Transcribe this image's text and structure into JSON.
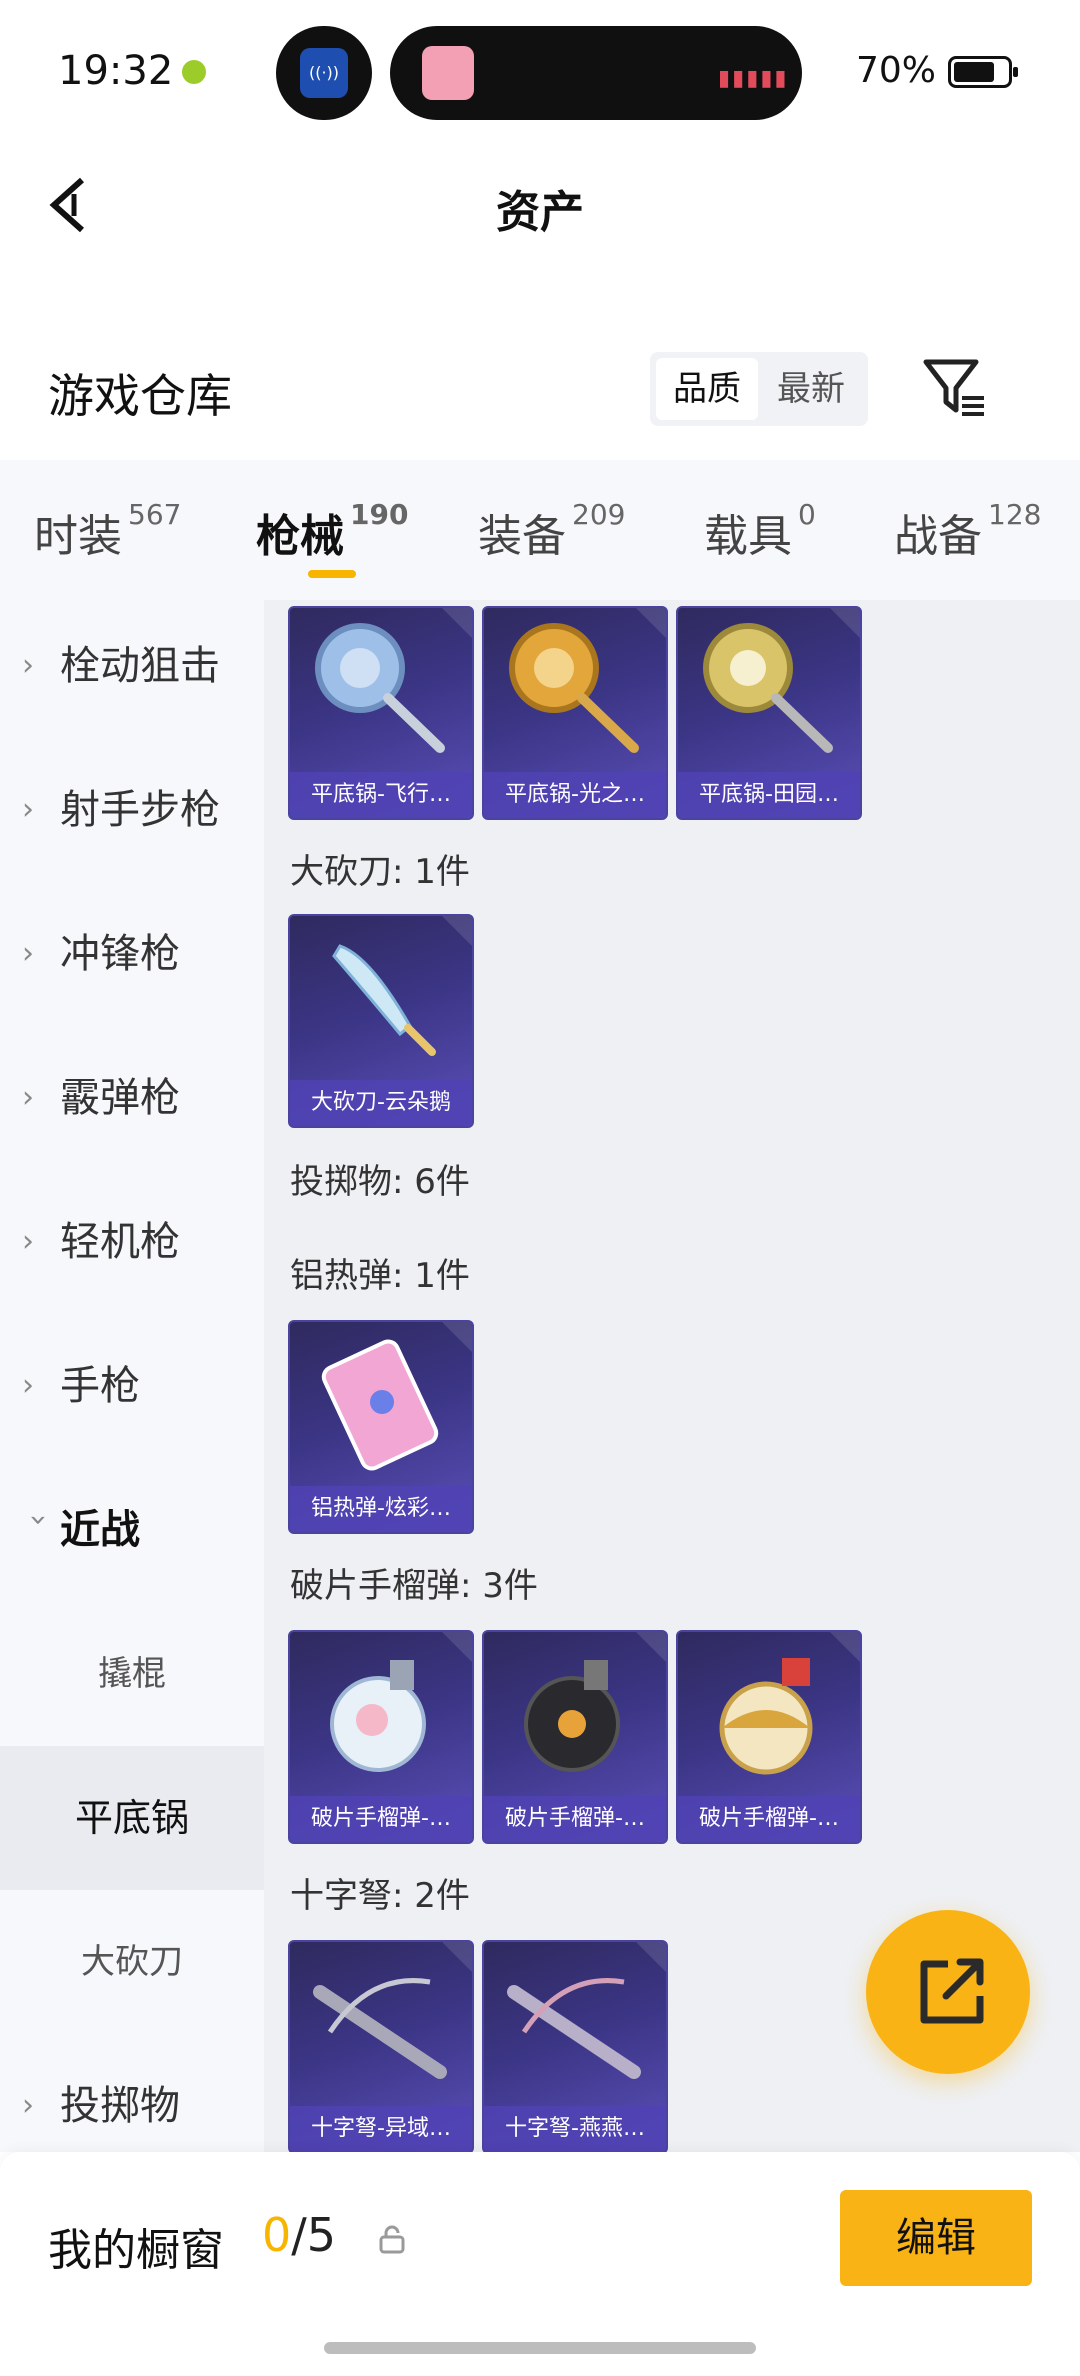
{
  "status_bar": {
    "time": "19:32",
    "battery": "70%",
    "battery_level": 0.7
  },
  "header": {
    "title": "资产",
    "back_icon": "chevron-left-icon"
  },
  "warehouse": {
    "title": "游戏仓库",
    "sort_options": [
      "品质",
      "最新"
    ],
    "active_sort": "品质",
    "filter_icon": "filter-icon"
  },
  "tabs": [
    {
      "label": "时装",
      "count": "567"
    },
    {
      "label": "枪械",
      "count": "190",
      "active": true
    },
    {
      "label": "装备",
      "count": "209"
    },
    {
      "label": "载具",
      "count": "0"
    },
    {
      "label": "战备",
      "count": "128"
    }
  ],
  "sidebar": {
    "categories": [
      {
        "label": "栓动狙击"
      },
      {
        "label": "射手步枪"
      },
      {
        "label": "冲锋枪"
      },
      {
        "label": "霰弹枪"
      },
      {
        "label": "轻机枪"
      },
      {
        "label": "手枪"
      },
      {
        "label": "近战",
        "open": true
      }
    ],
    "subcategories": [
      {
        "label": "撬棍"
      },
      {
        "label": "平底锅",
        "active": true
      },
      {
        "label": "大砍刀"
      }
    ],
    "more": [
      {
        "label": "投掷物"
      }
    ]
  },
  "content": {
    "pan_cards": [
      "平底锅-飞行…",
      "平底锅-光之…",
      "平底锅-田园…"
    ],
    "machete_title": "大砍刀: 1件",
    "machete_cards": [
      "大砍刀-云朵鹅"
    ],
    "throwables_title": "投掷物: 6件",
    "thermite_title": "铝热弹: 1件",
    "thermite_cards": [
      "铝热弹-炫彩…"
    ],
    "frag_title": "破片手榴弹: 3件",
    "frag_cards": [
      "破片手榴弹-…",
      "破片手榴弹-…",
      "破片手榴弹-…"
    ],
    "crossbow_title": "十字弩: 2件",
    "crossbow_cards": [
      "十字弩-异域…",
      "十字弩-燕燕…"
    ]
  },
  "fab": {
    "icon": "share-external-icon"
  },
  "bottom_bar": {
    "title": "我的橱窗",
    "count_current": "0",
    "count_total": "/5",
    "lock_icon": "lock-icon",
    "edit_label": "编辑"
  },
  "colors": {
    "accent": "#f9b315",
    "card_bg": "#3b3585",
    "card_label_bg": "#5042b4",
    "content_bg": "#eef0f4",
    "sidebar_bg": "#f7f8fb"
  }
}
